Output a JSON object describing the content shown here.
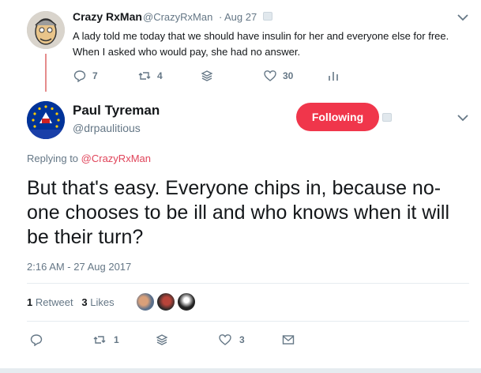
{
  "parent_tweet": {
    "author_name": "Crazy RxMan",
    "author_handle": "@CrazyRxMan",
    "separator": "·",
    "time": "Aug 27",
    "text": "A lady told me today that we should have insulin for her and everyone else for free. When I asked who would pay, she had no answer.",
    "actions": {
      "reply_count": "7",
      "retweet_count": "4",
      "like_count": "30"
    }
  },
  "main_tweet": {
    "author_name": "Paul Tyreman",
    "author_handle": "@drpaulitious",
    "follow_label": "Following",
    "replying_prefix": "Replying to ",
    "replying_handle": "@CrazyRxMan",
    "text": "But that's easy. Everyone chips in, because no-one chooses to be ill and who knows when it will be their turn?",
    "timestamp": "2:16 AM - 27 Aug 2017",
    "retweets_count": "1",
    "retweets_label": "Retweet",
    "likes_count": "3",
    "likes_label": "Likes",
    "actions": {
      "retweet_count": "1",
      "like_count": "3"
    }
  },
  "colors": {
    "accent": "#f0364b",
    "handle_link": "#e0445a",
    "muted": "#657786",
    "thread_line": "#e58c8c"
  }
}
